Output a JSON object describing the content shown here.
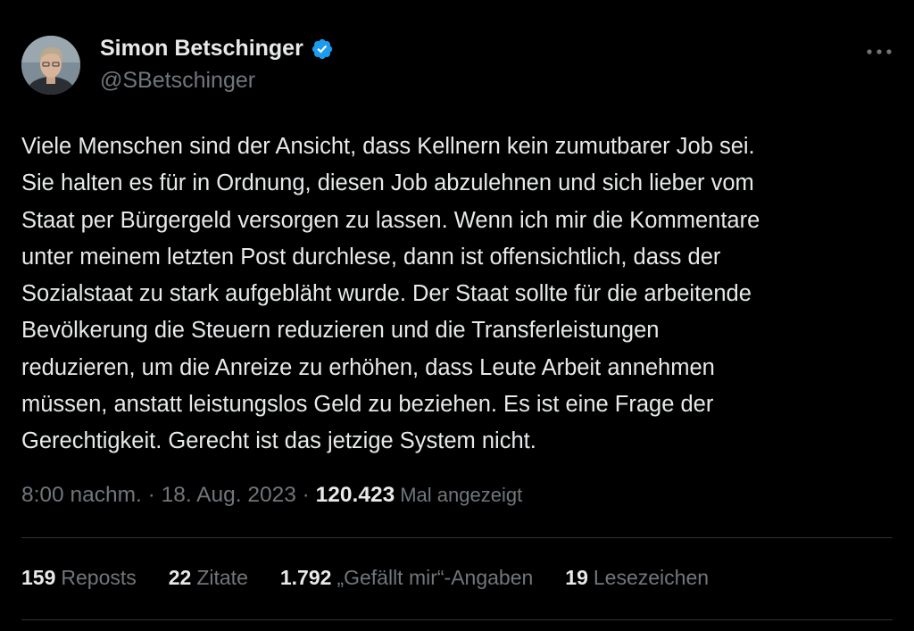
{
  "author": {
    "name": "Simon Betschinger",
    "handle": "@SBetschinger",
    "verified_icon": "verified-badge-icon"
  },
  "tweet": {
    "text": "Viele Menschen sind der Ansicht, dass Kellnern kein zumutbarer Job sei.\nSie halten es für in Ordnung, diesen Job abzulehnen und sich lieber vom\nStaat per Bürgergeld versorgen zu lassen. Wenn ich mir die Kommentare\nunter meinem letzten Post durchlese, dann ist offensichtlich, dass der\nSozialstaat zu stark aufgebläht wurde. Der Staat sollte für die arbeitende\nBevölkerung die Steuern reduzieren und die Transferleistungen\nreduzieren, um die Anreize zu erhöhen, dass Leute Arbeit annehmen\nmüssen, anstatt leistungslos Geld zu beziehen. Es ist eine Frage der\nGerechtigkeit. Gerecht ist das jetzige System nicht."
  },
  "meta": {
    "time": "8:00 nachm.",
    "sep1": " · ",
    "date": "18. Aug. 2023",
    "sep2": " · ",
    "views_count": "120.423",
    "views_label": "Mal angezeigt"
  },
  "stats": [
    {
      "count": "159",
      "label": "Reposts"
    },
    {
      "count": "22",
      "label": "Zitate"
    },
    {
      "count": "1.792",
      "label": "„Gefällt mir“-Angaben"
    },
    {
      "count": "19",
      "label": "Lesezeichen"
    }
  ],
  "colors": {
    "background": "#000000",
    "text": "#e7e9ea",
    "secondary": "#71767b",
    "verified": "#1d9bf0",
    "divider": "#2f3336"
  },
  "icons": {
    "more": "more-dots-icon"
  }
}
